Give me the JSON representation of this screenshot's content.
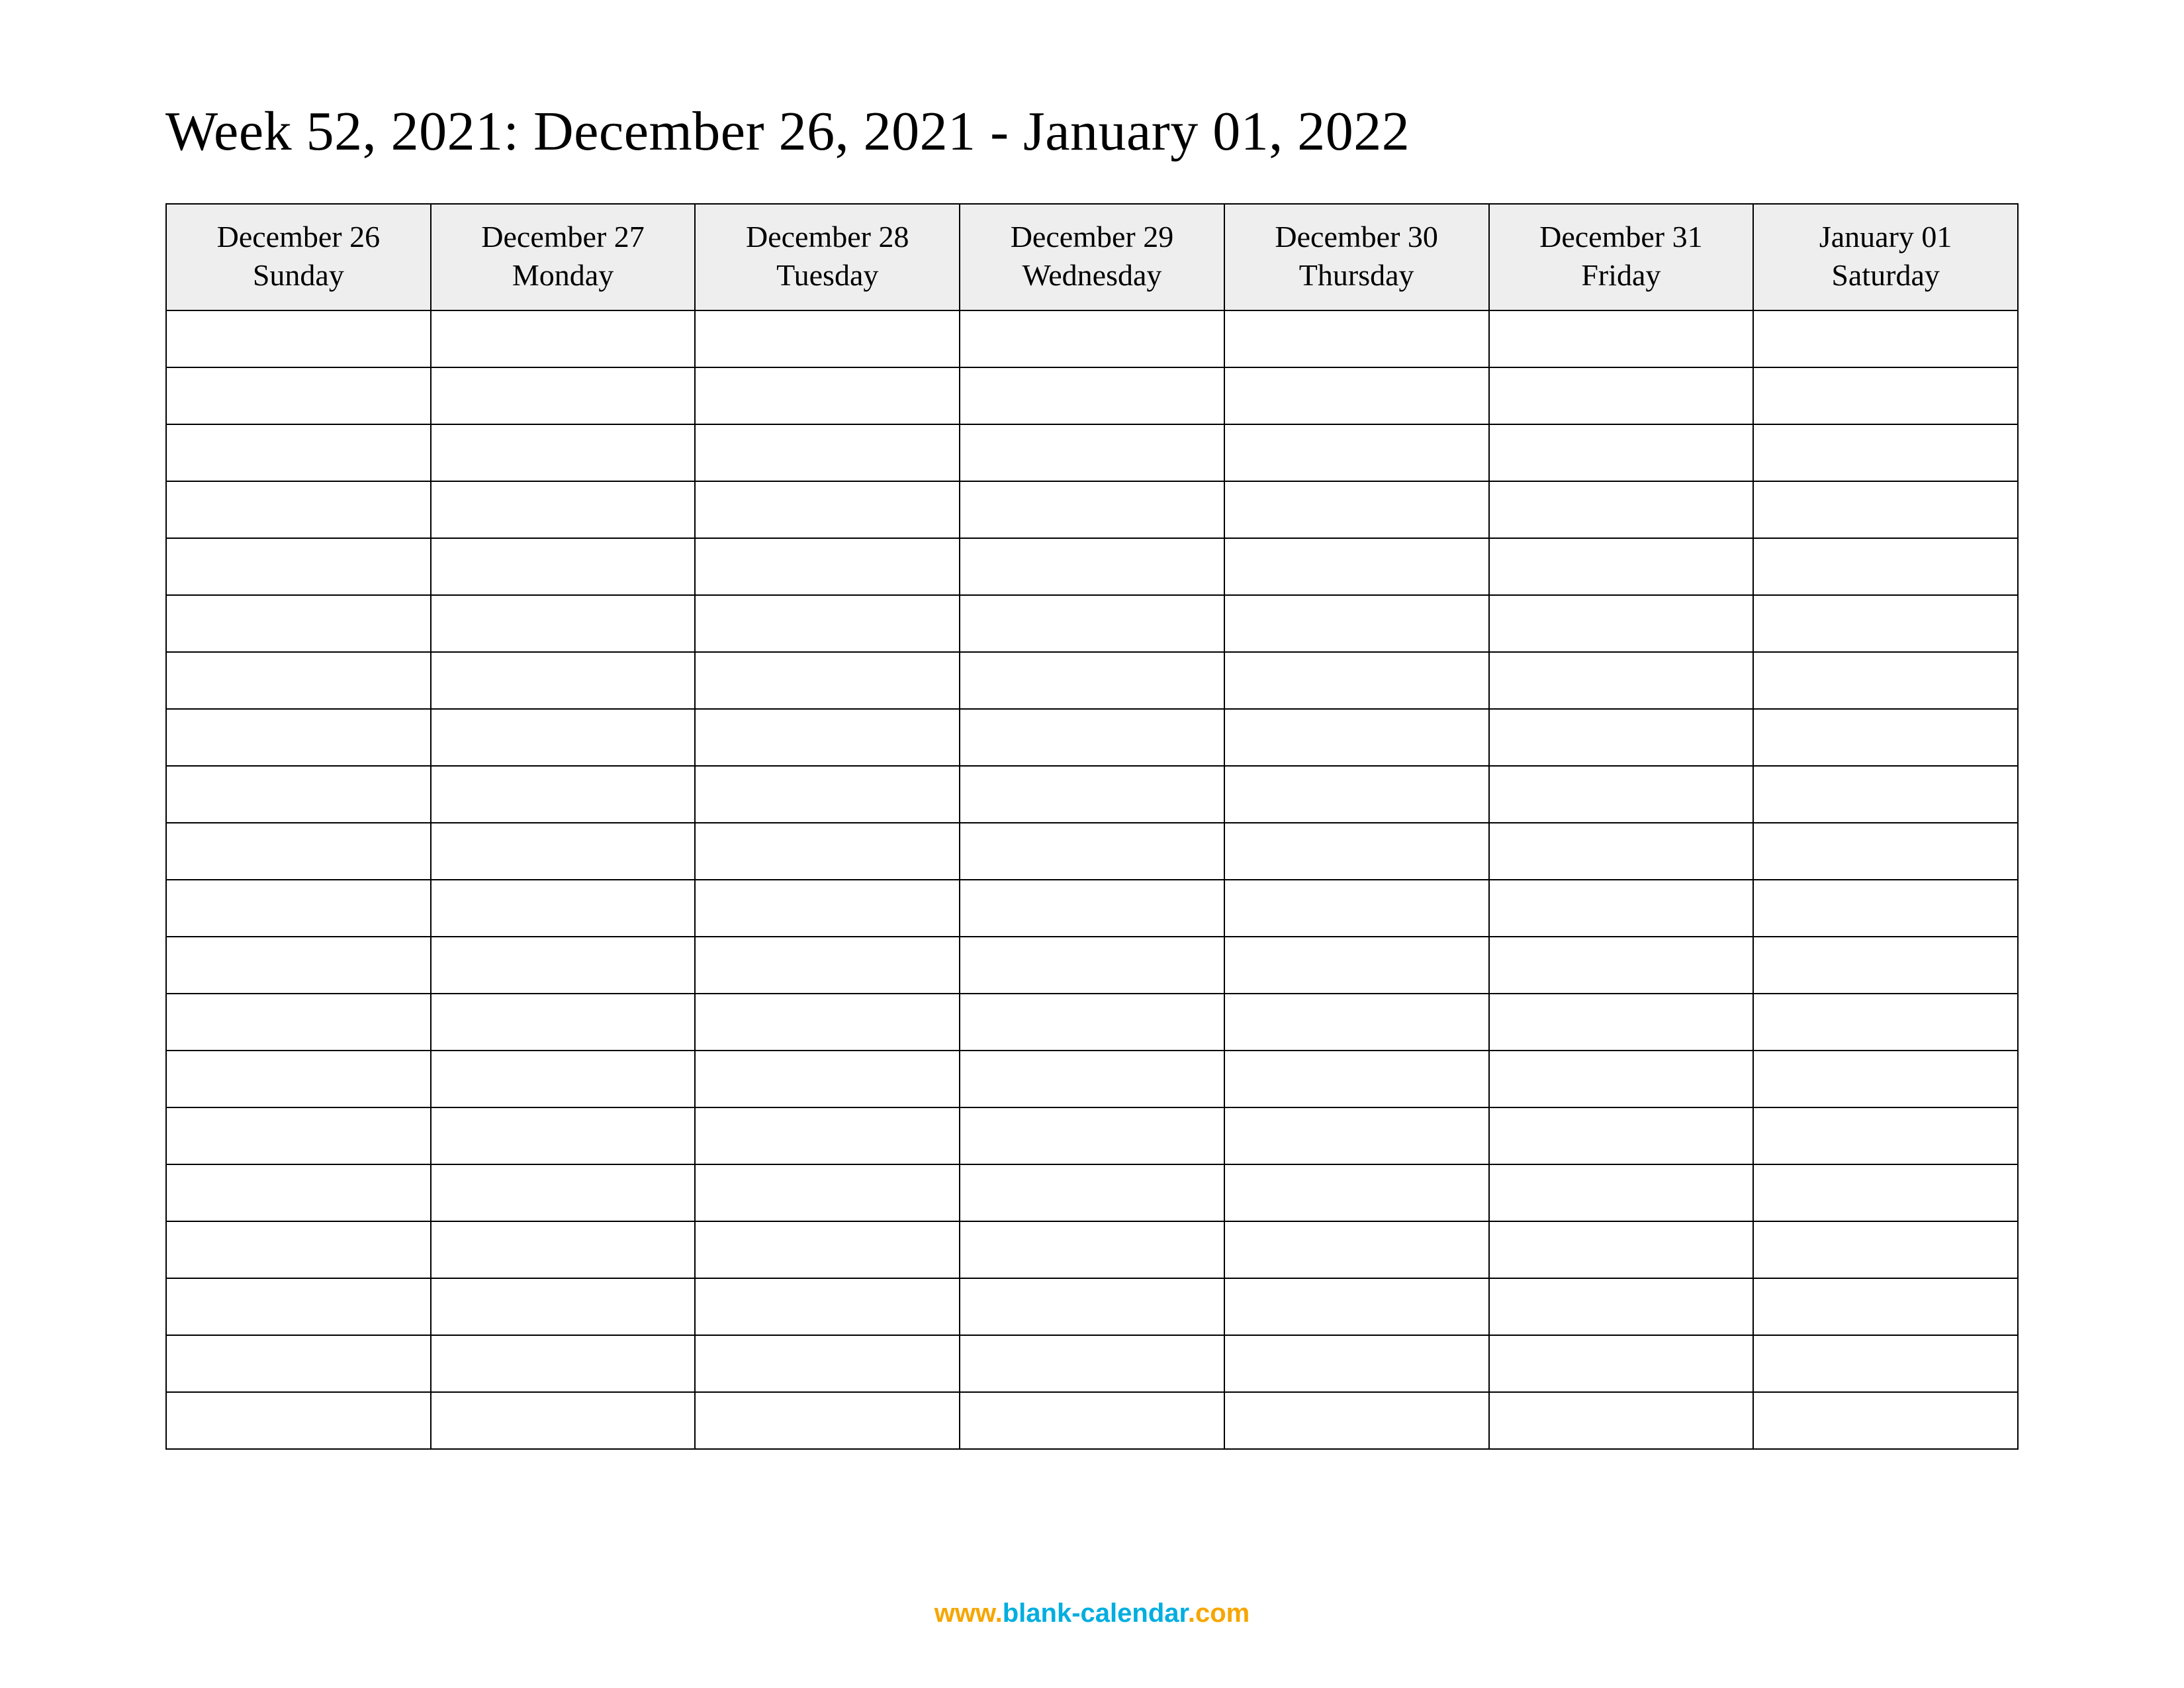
{
  "title": "Week 52, 2021: December 26, 2021 - January 01, 2022",
  "columns": [
    {
      "date": "December 26",
      "day": "Sunday"
    },
    {
      "date": "December 27",
      "day": "Monday"
    },
    {
      "date": "December 28",
      "day": "Tuesday"
    },
    {
      "date": "December 29",
      "day": "Wednesday"
    },
    {
      "date": "December 30",
      "day": "Thursday"
    },
    {
      "date": "December 31",
      "day": "Friday"
    },
    {
      "date": "January 01",
      "day": "Saturday"
    }
  ],
  "blank_rows": 20,
  "footer": {
    "part1": "www.",
    "part2": "blank-calendar",
    "part3": ".com"
  }
}
